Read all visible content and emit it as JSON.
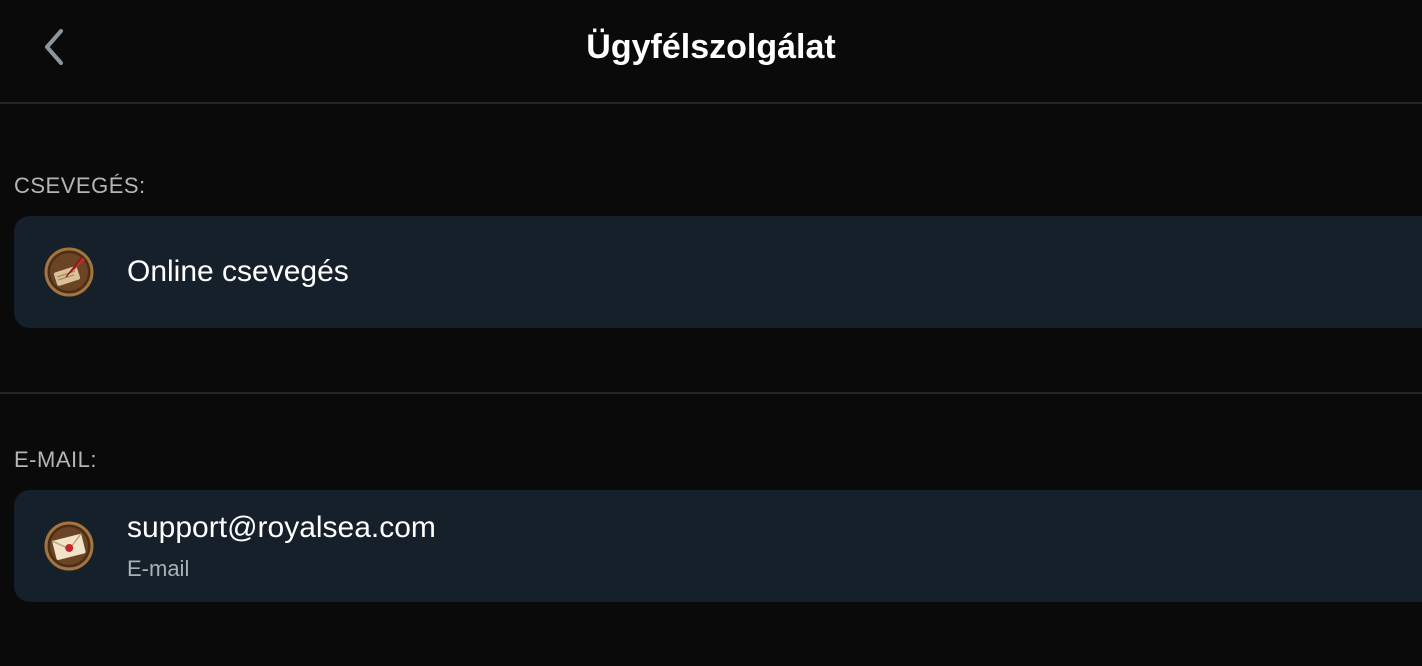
{
  "header": {
    "title": "Ügyfélszolgálat",
    "back_icon": "chevron-left-icon"
  },
  "sections": [
    {
      "label": "CSEVEGÉS:",
      "item": {
        "title": "Online csevegés",
        "icon": "quill-pen-icon"
      }
    },
    {
      "label": "E-MAIL:",
      "item": {
        "title": "support@royalsea.com",
        "subtitle": "E-mail",
        "icon": "envelope-icon"
      }
    }
  ],
  "colors": {
    "background": "#0a0a0a",
    "card": "#15202a",
    "divider": "#232527",
    "label": "#b3b5b8",
    "icon_bronze": "#8a5a2b"
  }
}
